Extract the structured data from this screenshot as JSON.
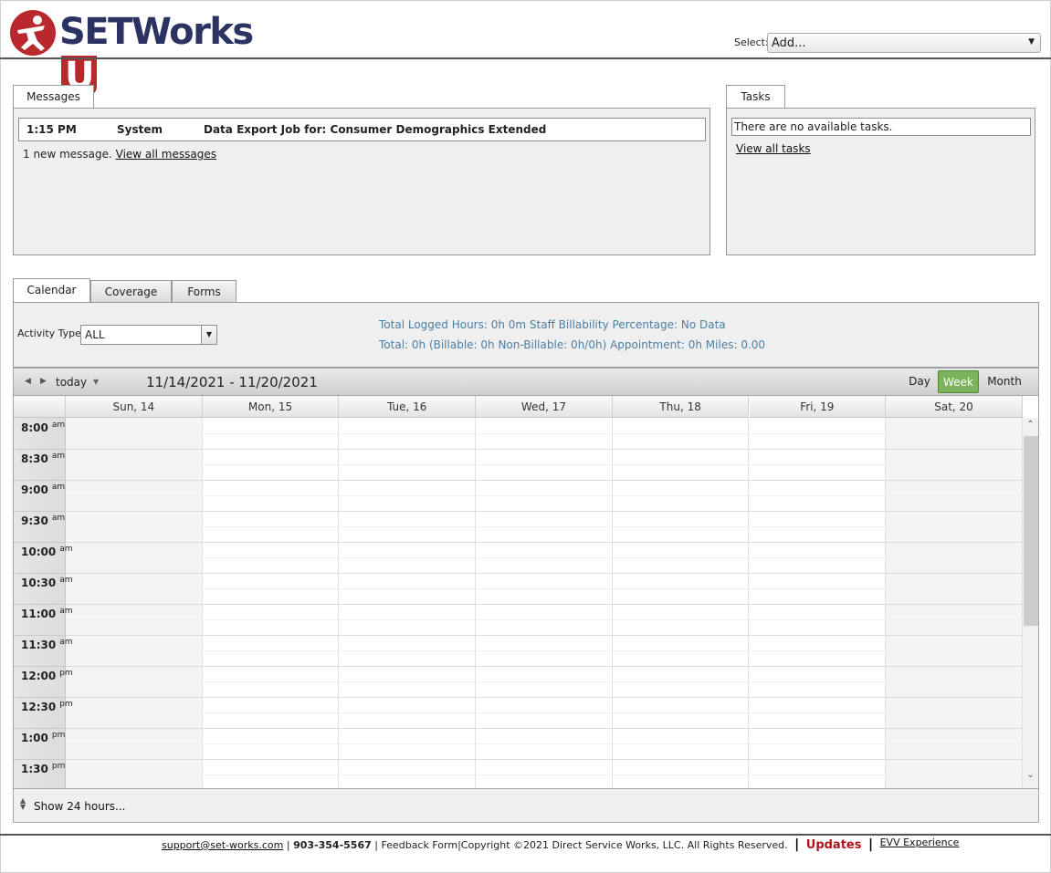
{
  "brand": {
    "name": "SETWorks",
    "suffix": "U",
    "colors": {
      "red": "#b8282c",
      "navy": "#2b3363"
    }
  },
  "header": {
    "select_label": "Select:",
    "select_value": "Add..."
  },
  "messages": {
    "tab_label": "Messages",
    "rows": [
      {
        "time": "1:15 PM",
        "from": "System",
        "subject": "Data Export Job for: Consumer Demographics Extended"
      }
    ],
    "note_prefix": "1 new message.",
    "view_all": "View all messages"
  },
  "tasks": {
    "tab_label": "Tasks",
    "empty_text": "There are no available tasks.",
    "view_all": "View all tasks"
  },
  "bottom_tabs": [
    "Calendar",
    "Coverage",
    "Forms"
  ],
  "filter": {
    "activity_label": "Activity Type:",
    "activity_value": "ALL",
    "stats_line1": "Total Logged Hours: 0h 0m   Staff Billability Percentage: No Data",
    "stats_line2": "Total: 0h   (Billable: 0h   Non-Billable: 0h/0h)   Appointment: 0h   Miles: 0.00"
  },
  "calendar": {
    "today_label": "today",
    "range": "11/14/2021 - 11/20/2021",
    "views": [
      "Day",
      "Week",
      "Month"
    ],
    "active_view": "Week",
    "days": [
      "Sun, 14",
      "Mon, 15",
      "Tue, 16",
      "Wed, 17",
      "Thu, 18",
      "Fri, 19",
      "Sat, 20"
    ],
    "times": [
      {
        "t": "8:00",
        "p": "am"
      },
      {
        "t": "8:30",
        "p": "am"
      },
      {
        "t": "9:00",
        "p": "am"
      },
      {
        "t": "9:30",
        "p": "am"
      },
      {
        "t": "10:00",
        "p": "am"
      },
      {
        "t": "10:30",
        "p": "am"
      },
      {
        "t": "11:00",
        "p": "am"
      },
      {
        "t": "11:30",
        "p": "am"
      },
      {
        "t": "12:00",
        "p": "pm"
      },
      {
        "t": "12:30",
        "p": "pm"
      },
      {
        "t": "1:00",
        "p": "pm"
      },
      {
        "t": "1:30",
        "p": "pm"
      }
    ],
    "show_24": "Show 24 hours...",
    "active_color": "#7bb35d"
  },
  "footer": {
    "support_email": "support@set-works.com",
    "phone": "903-354-5567",
    "feedback": "Feedback Form",
    "copyright": "Copyright ©2021 Direct Service Works, LLC. All Rights Reserved.",
    "updates": "Updates",
    "evv": "EVV Experience"
  }
}
